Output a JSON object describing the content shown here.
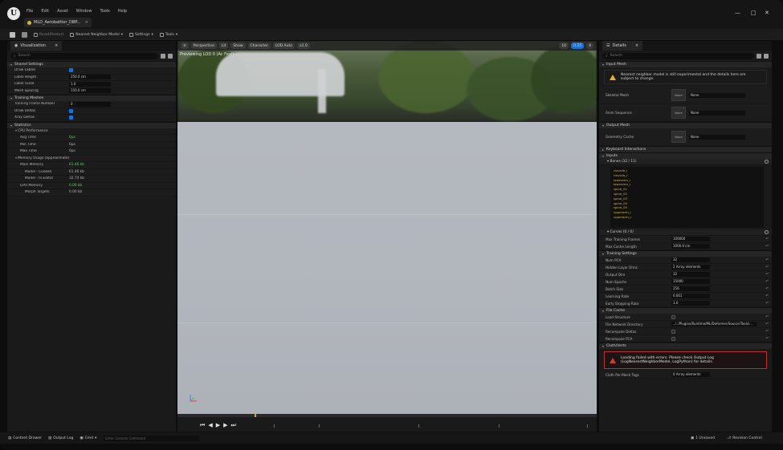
{
  "menu": [
    "File",
    "Edit",
    "Asset",
    "Window",
    "Tools",
    "Help"
  ],
  "doc_tab": "MLD_Aerobattler_DBP...",
  "toolbar": {
    "save_label": "",
    "disabled_label": "Reset/Restart",
    "mode_label": "Nearest Neighbor Model",
    "settings_label": "Settings",
    "tools_label": "Tools"
  },
  "left_panel": {
    "tab_label": "Visualization",
    "search_placeholder": "Search",
    "sections": {
      "shared": "Shared Settings",
      "training": "Training Meshes",
      "stats": "Statistics"
    },
    "shared_rows": [
      {
        "label": "Draw Labels",
        "kind": "check"
      },
      {
        "label": "Label Height",
        "value": "250.0 cm"
      },
      {
        "label": "Label Scale",
        "value": "1.0"
      },
      {
        "label": "Mesh Spacing",
        "value": "150.0 cm"
      }
    ],
    "training_rows": [
      {
        "label": "Training Frame Number",
        "value": "0"
      },
      {
        "label": "Draw Deltas",
        "kind": "check"
      },
      {
        "label": "Xray Deltas",
        "kind": "check"
      }
    ],
    "stats_rows": [
      {
        "label": "CPU Performance",
        "indent": 1,
        "kind": "header"
      },
      {
        "label": "Avg Time",
        "value": "0μs",
        "color": "green",
        "indent": 2
      },
      {
        "label": "Min Time",
        "value": "0μs",
        "indent": 2
      },
      {
        "label": "Max Time",
        "value": "0μs",
        "indent": 2
      },
      {
        "label": "Memory Usage (approximate)",
        "indent": 1,
        "kind": "header"
      },
      {
        "label": "Main Memory",
        "value": "61.46 kb",
        "color": "green",
        "indent": 2
      },
      {
        "label": "Model - Cooked",
        "value": "61.46 kb",
        "indent": 3
      },
      {
        "label": "Model - In Editor",
        "value": "32.74 kb",
        "indent": 3
      },
      {
        "label": "GPU Memory",
        "value": "0.00 kb",
        "color": "green",
        "indent": 2
      },
      {
        "label": "Morph Targets",
        "value": "0.00 kb",
        "indent": 3
      }
    ]
  },
  "viewport": {
    "buttons": [
      "Perspective",
      "Lit",
      "Show",
      "Character",
      "LOD Auto",
      "x1.0"
    ],
    "right_buttons": [
      "10",
      "0.25",
      "4"
    ],
    "overlay_label": "Previewing LOD 0 (Ac Feel)"
  },
  "details": {
    "tab_label": "Details",
    "search_placeholder": "Search",
    "sections": {
      "assets": "Input Mesh",
      "output": "Output Mesh",
      "keyboard": "Keyboard Interactions",
      "inputs": "Inputs",
      "training": "Training Settings",
      "file_cache": "File Cache",
      "cloth": "Cloth/Verts"
    },
    "warning_text": "Nearest neighbor model is still experimental and the details here are subject to change.",
    "asset_rows": [
      {
        "label": "Skeletal Mesh",
        "thumb": "None",
        "dropdown": "None"
      },
      {
        "label": "Anim Sequence",
        "thumb": "None",
        "dropdown": "None"
      }
    ],
    "output_rows": [
      {
        "label": "Geometry Cache",
        "thumb": "None",
        "dropdown": "None"
      }
    ],
    "bones_header": "Bones (32 / 11)",
    "bones": [
      "clavicle_l",
      "clavicle_r",
      "lowerarm_l",
      "lowerarm_r",
      "spine_01",
      "spine_02",
      "spine_03",
      "spine_04",
      "spine_05",
      "upperarm_l",
      "upperarm_r"
    ],
    "curves_header": "Curves (0 / 0)",
    "input_rows": [
      {
        "label": "Max Training Frames",
        "value": "100000"
      },
      {
        "label": "Max Cache Length",
        "value": "1000.0 cm"
      }
    ],
    "training_rows": [
      {
        "label": "Num PCA",
        "value": "32"
      },
      {
        "label": "Hidden Layer Dims",
        "value": "2 Array elements"
      },
      {
        "label": "Output Dim",
        "value": "32"
      },
      {
        "label": "Num Epochs",
        "value": "15000"
      },
      {
        "label": "Batch Size",
        "value": "256"
      },
      {
        "label": "Learning Rate",
        "value": "0.001"
      },
      {
        "label": "Early Stopping Rate",
        "value": "1.0"
      }
    ],
    "file_cache_rows": [
      {
        "label": "Load Structure",
        "kind": "check"
      },
      {
        "label": "File Network Directory",
        "value": "../../Plugins/Runtime/ML/Deformer/Source/Tools/..."
      },
      {
        "label": "Recompute Deltas",
        "kind": "check"
      },
      {
        "label": "Recompute PCA",
        "kind": "check"
      }
    ],
    "error_text": "Loading failed with errors. Please check Output Log (LogNearestNeighborModel, LogPython) for details.",
    "bottom_row": {
      "label": "Cloth Per-Mesh Tags",
      "value": "0 Array elements"
    }
  },
  "statusbar": {
    "content_drawer": "Content Drawer",
    "output_log": "Output Log",
    "cmd_label": "Cmd",
    "cmd_placeholder": "Enter Console Command",
    "unsaved": "1 Unsaved",
    "revision": "Revision Control"
  }
}
